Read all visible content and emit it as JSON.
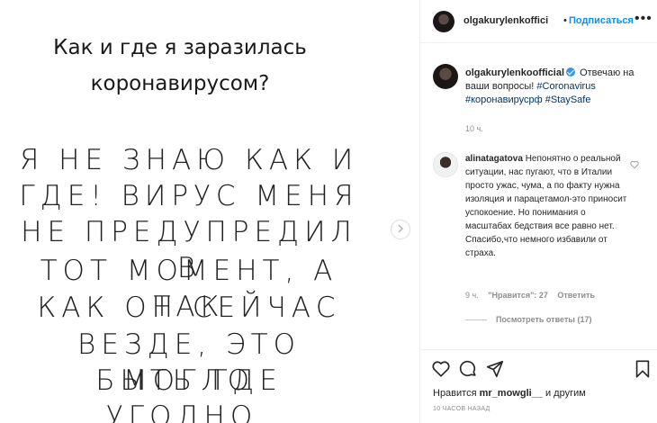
{
  "media": {
    "title_lines": [
      "Как и где я заразилась",
      "коронавирусом?"
    ],
    "body_lines": [
      "Я НЕ ЗНАЮ КАК И",
      "ГДЕ! ВИРУС МЕНЯ",
      "НЕ ПРЕДУПРЕДИЛ В",
      "ТОТ МОМЕНТ, А ТАК",
      "КАК ОН СЕЙЧАС",
      "ВЕЗДЕ, ЭТО МОГЛО",
      "БЫТЬ ГДЕ УГОДНО."
    ],
    "next_icon": "chevron-right-icon"
  },
  "header": {
    "username": "olgakurylenkoffici",
    "separator": "•",
    "follow_label": "Подписаться",
    "more_label": "•••"
  },
  "caption": {
    "username": "olgakurylenkoofficial",
    "text": " Отвечаю на ваши вопросы! ",
    "hashtags": [
      "#Coronavirus",
      "#коронавирусрф",
      "#StaySafe"
    ],
    "time": "10 ч."
  },
  "comment": {
    "username": "alinatagatova",
    "text": " Непонятно о реальной ситуации, нас пугают, что в Италии просто ужас, чума, а по факту нужна изоляция и парацетамол-это приносит успокоение. Но понимания о масштабах бедствия все равно нет. Спасибо,что немного избавили от страха.",
    "time": "9 ч.",
    "likes": "\"Нравится\": 27",
    "reply_label": "Ответить",
    "view_replies": "Посмотреть ответы (17)"
  },
  "actions": {
    "likes_prefix": "Нравится ",
    "likes_user": "mr_mowgli__",
    "likes_suffix": " и другим",
    "time_ago": "10 ЧАСОВ НАЗАД"
  },
  "colors": {
    "accent": "#0095f6",
    "verified": "#3897f0",
    "hashtag": "#00376b",
    "muted": "#8e8e8e"
  }
}
